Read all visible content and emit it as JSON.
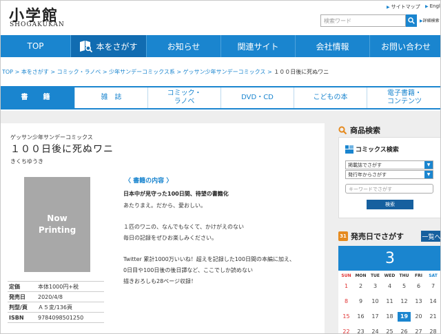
{
  "header": {
    "logo_main": "小学館",
    "logo_sub": "SHOGAKUKAN",
    "util_links": [
      "サイトマップ",
      "Engli"
    ],
    "search_placeholder": "検索ワード",
    "advanced_link": "詳細検索"
  },
  "gnav": [
    "TOP",
    "本をさがす",
    "お知らせ",
    "関連サイト",
    "会社情報",
    "お問い合わせ"
  ],
  "breadcrumb": {
    "items": [
      "TOP",
      "本をさがす",
      "コミック・ラノベ",
      "少年サンデーコミックス系",
      "ゲッサン少年サンデーコミックス"
    ],
    "separator": ">",
    "current": "１００日後に死ぬワニ"
  },
  "category_tabs": [
    "書　籍",
    "雑　誌",
    "コミック・\nラノベ",
    "DVD・CD",
    "こどもの本",
    "電子書籍・\nコンテンツ"
  ],
  "book": {
    "series": "ゲッサン少年サンデーコミックス",
    "title": "１００日後に死ぬワニ",
    "author": "きくちゆうき",
    "cover_text": "Now\nPrinting",
    "specs": [
      {
        "k": "定価",
        "v": "本体1000円+税"
      },
      {
        "k": "発売日",
        "v": "2020/4/8"
      },
      {
        "k": "判型/頁",
        "v": "Ａ５変/136頁"
      },
      {
        "k": "ISBN",
        "v": "9784098501250"
      }
    ],
    "contents_heading": "〈 書籍の内容 〉",
    "lead": "日本中が見守った100日間、待望の書籍化",
    "desc": [
      "あたりまえ。だから、愛おしい。",
      "",
      "１匹のワニの、なんでもなくて、かけがえのない",
      "毎日の記録をぜひお楽しみください。",
      "",
      "Twitter 累計1000万いいね！超えを記録した100日間の本編に加え、",
      "0日目や100日後の後日譚など、ここでしか読めない",
      "描きおろしも28ページ収録！"
    ]
  },
  "sidebar": {
    "search_title": "商品検索",
    "comic_search_title": "コミックス検索",
    "select_label": "掲載誌でさがす",
    "select_date": "発行年からさがす",
    "keyword_placeholder": "キーワードでさがす",
    "search_button": "検索",
    "release_title": "発売日でさがす",
    "release_badge": "31",
    "list_button": "一覧へ",
    "month": "3",
    "weekdays": [
      "SUN",
      "MON",
      "TUE",
      "WED",
      "THU",
      "FRI",
      "SAT"
    ],
    "weeks": [
      [
        "1",
        "2",
        "3",
        "4",
        "5",
        "6",
        "7"
      ],
      [
        "8",
        "9",
        "10",
        "11",
        "12",
        "13",
        "14"
      ],
      [
        "15",
        "16",
        "17",
        "18",
        "19",
        "20",
        "21"
      ],
      [
        "22",
        "23",
        "24",
        "25",
        "26",
        "27",
        "28"
      ]
    ],
    "today": "19"
  },
  "colors": {
    "accent": "#1a85cf",
    "accent_dark": "#116cb1",
    "button": "#16609f",
    "sunday": "#e03030",
    "search_icon_orange": "#e58a1f"
  }
}
